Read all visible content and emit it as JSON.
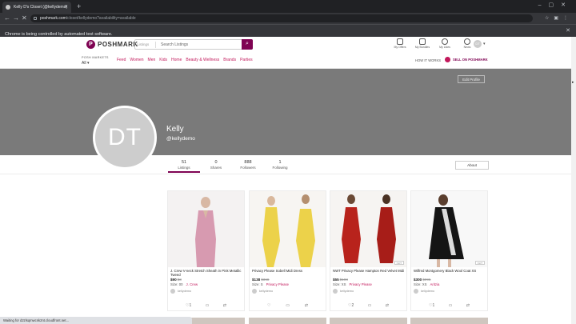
{
  "browser": {
    "tab_title": "Kelly D's Closet (@kellydemo)",
    "url_host": "poshmark.com",
    "url_path": "/closet/kellydemo?availability=available",
    "infobar_text": "Chrome is being controlled by automated test software.",
    "status_text": "Waiting for d2zlsqmwcnk2nt.cloudfront.net..."
  },
  "header": {
    "logo_text": "POSHMARK",
    "search_scope": "Listings",
    "search_placeholder": "Search Listings",
    "icons": [
      {
        "name": "my-offers",
        "label": "My Offers"
      },
      {
        "name": "my-bundles",
        "label": "My Bundles"
      },
      {
        "name": "my-likes",
        "label": "My Likes"
      },
      {
        "name": "news",
        "label": "News"
      }
    ],
    "avatar_initials": "DT",
    "shop_for_label": "POSH MARKETS",
    "shop_for_value": "All",
    "categories": [
      "Feed",
      "Women",
      "Men",
      "Kids",
      "Home",
      "Beauty & Wellness",
      "Brands",
      "Parties"
    ],
    "how_it_works": "HOW IT WORKS",
    "sell_label": "SELL ON POSHMARK"
  },
  "profile": {
    "edit_label": "Edit Profile",
    "initials": "DT",
    "name": "Kelly",
    "handle": "@kellydemo",
    "stats": [
      {
        "count": "51",
        "label": "Listings"
      },
      {
        "count": "0",
        "label": "Shares"
      },
      {
        "count": "888",
        "label": "Followers"
      },
      {
        "count": "1",
        "label": "Following"
      }
    ],
    "about_label": "About"
  },
  "listings": [
    {
      "title": "J. Crew V-neck Stretch Sheath in Pink Metallic Tweed",
      "price": "$90",
      "orig": "$3",
      "size": "Size: 00",
      "brand": "J. Crew",
      "seller": "kellydemo",
      "likes": "1",
      "badge": ""
    },
    {
      "title": "Privacy Please Sobell Midi Dress",
      "price": "$138",
      "orig": "$368",
      "size": "Size: S",
      "brand": "Privacy Please",
      "seller": "kellydemo",
      "likes": "",
      "badge": ""
    },
    {
      "title": "NWT Privacy Please Hampton Red Velvet Midi",
      "price": "$55",
      "orig": "$198",
      "size": "Size: XS",
      "brand": "Privacy Please",
      "seller": "kellydemo",
      "likes": "2",
      "badge": "NWT"
    },
    {
      "title": "Wilfred Montgomery Black Wool Coat XS",
      "price": "$300",
      "orig": "$995",
      "size": "Size: XS",
      "brand": "Aritzia",
      "seller": "kellydemo",
      "likes": "1",
      "badge": "NWT"
    }
  ],
  "colors": {
    "brand": "#7f0353",
    "accent": "#c2185b",
    "cover": "#7a7a7a"
  }
}
